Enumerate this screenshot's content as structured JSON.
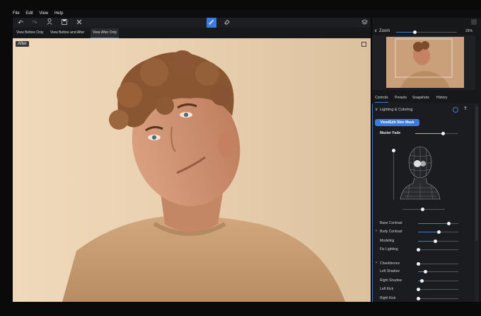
{
  "menu": [
    "File",
    "Edit",
    "View",
    "Help"
  ],
  "toolbar": {
    "undo_icon": "undo-icon",
    "redo_icon": "redo-icon",
    "person_icon": "person-icon",
    "save_icon": "save-icon",
    "close_icon": "close-icon",
    "brush_icon": "brush-icon",
    "eraser_icon": "eraser-icon",
    "layers_icon": "layers-icon"
  },
  "view_tabs": [
    {
      "label": "View Before Only"
    },
    {
      "label": "View Before and After"
    },
    {
      "label": "View After Only",
      "active": true
    }
  ],
  "photo": {
    "label": "After"
  },
  "zoom": {
    "label": "Zoom",
    "value": "25%",
    "level": 0.3
  },
  "panel_tabs": [
    {
      "label": "Controls",
      "active": true
    },
    {
      "label": "Presets"
    },
    {
      "label": "Snapshots"
    },
    {
      "label": "History"
    }
  ],
  "section": {
    "title": "Lighting & Coloring",
    "help": "?"
  },
  "skin_mask_button": "View/Edit Skin Mask",
  "master_fade": {
    "label": "Master Fade",
    "level": 0.65
  },
  "sliders": [
    {
      "label": "Base Contrast",
      "level": 0.75,
      "expandable": false
    },
    {
      "label": "Body Contrast",
      "level": 0.5,
      "expandable": true
    },
    {
      "label": "Modeling",
      "level": 0.42,
      "expandable": false
    },
    {
      "label": "Fix Lighting",
      "level": 0.0,
      "expandable": false
    },
    {
      "label": "Cheekbones",
      "level": 0.0,
      "expandable": true
    },
    {
      "label": "Left Shadow",
      "level": 0.18,
      "expandable": false
    },
    {
      "label": "Right Shadow",
      "level": 0.08,
      "expandable": false
    },
    {
      "label": "Left Kick",
      "level": 0.0,
      "expandable": false
    },
    {
      "label": "Right Kick",
      "level": 0.0,
      "expandable": false
    }
  ],
  "colors": {
    "accent": "#3b7be0",
    "panel": "#1b1c1f",
    "photo_bg": "#ecd4b4"
  }
}
